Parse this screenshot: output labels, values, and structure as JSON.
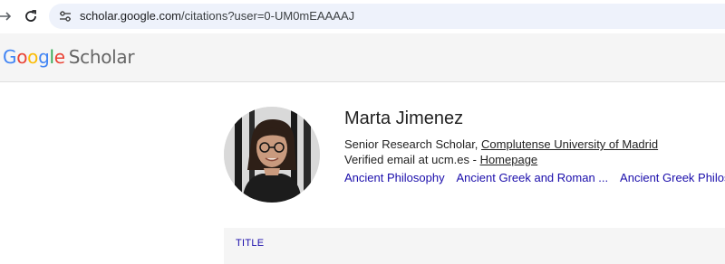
{
  "browser": {
    "url_host": "scholar.google.com",
    "url_path": "/citations?user=0-UM0mEAAAAJ",
    "icons": [
      "arrow-forward-icon",
      "reload-icon",
      "site-settings-icon"
    ]
  },
  "header": {
    "logo_letters": [
      "G",
      "o",
      "o",
      "g",
      "l",
      "e"
    ],
    "logo_suffix": "Scholar"
  },
  "profile": {
    "name": "Marta Jimenez",
    "title_prefix": "Senior Research Scholar, ",
    "institution": "Complutense University of Madrid",
    "verified_prefix": "Verified email at ucm.es - ",
    "homepage_label": "Homepage",
    "interests": [
      "Ancient Philosophy",
      "Ancient Greek and Roman ...",
      "Ancient Greek Philoso"
    ]
  },
  "table": {
    "title_header": "TITLE"
  },
  "colors": {
    "link": "#1a0dab",
    "header_bg": "#f5f5f5",
    "address_bg": "#eef2fb"
  }
}
